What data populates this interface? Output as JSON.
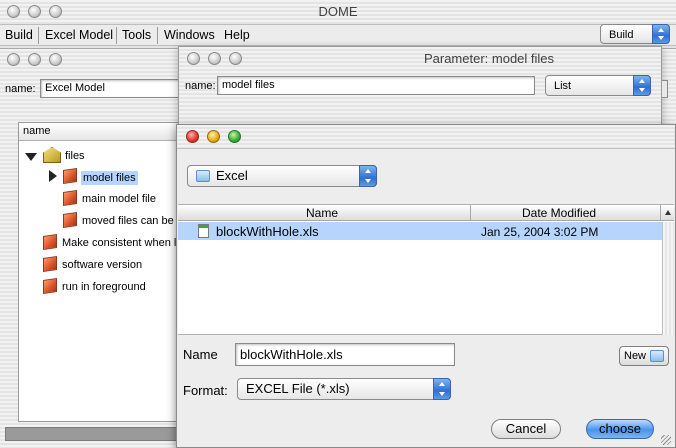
{
  "main_window": {
    "title": "DOME",
    "menu": [
      "Build",
      "Excel Model",
      "Tools",
      "Windows",
      "Help"
    ],
    "mode_select": "Build"
  },
  "model_window": {
    "name_label": "name:",
    "name_value": "Excel Model",
    "tree_header": "name",
    "tree": {
      "root": "files",
      "children": [
        "model files",
        "main model file",
        "moved files can be"
      ],
      "items": [
        "Make consistent when l",
        "software version",
        "run in foreground"
      ]
    }
  },
  "param_window": {
    "title": "Parameter: model files",
    "name_label": "name:",
    "name_value": "model files",
    "type_select": "List"
  },
  "file_dialog": {
    "location": "Excel",
    "columns": [
      "Name",
      "Date Modified"
    ],
    "files": [
      {
        "name": "blockWithHole.xls",
        "date": "Jan 25, 2004 3:02 PM",
        "selected": true
      }
    ],
    "name_label": "Name",
    "name_value": "blockWithHole.xls",
    "new_button": "New",
    "format_label": "Format:",
    "format_value": "EXCEL File (*.xls)",
    "cancel_button": "Cancel",
    "choose_button": "choose"
  }
}
